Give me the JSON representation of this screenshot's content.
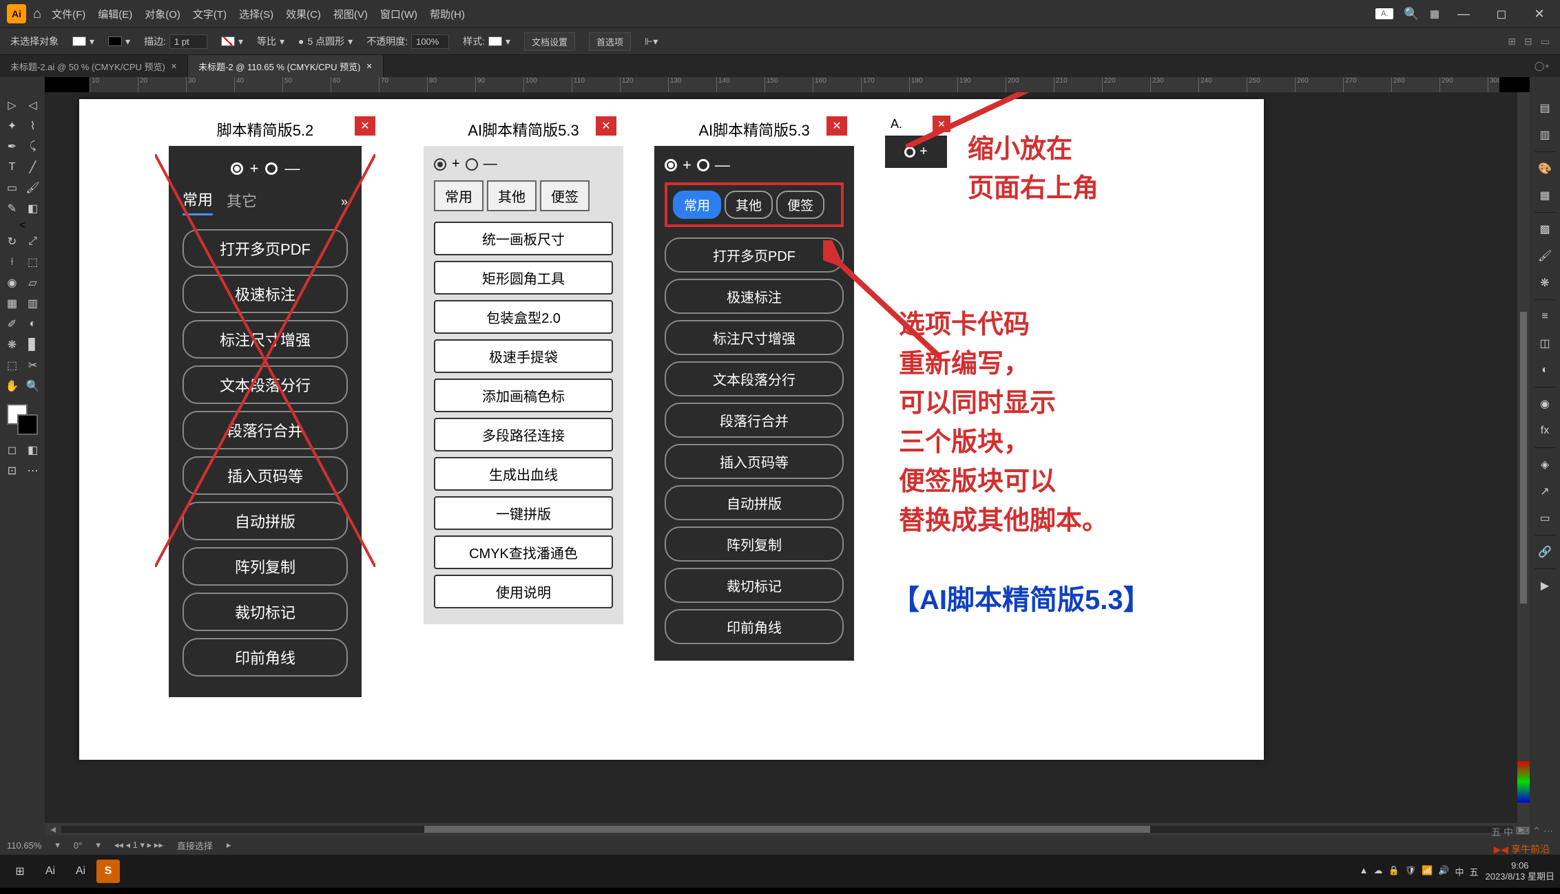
{
  "menubar": {
    "items": [
      "文件(F)",
      "编辑(E)",
      "对象(O)",
      "文字(T)",
      "选择(S)",
      "效果(C)",
      "视图(V)",
      "窗口(W)",
      "帮助(H)"
    ],
    "small_box": "A.",
    "search_icon": "search",
    "layout_icon": "layout"
  },
  "controlbar": {
    "noselect": "未选择对象",
    "stroke_label": "描边:",
    "stroke_val": "1 pt",
    "uniform": "等比",
    "pt_round": "5 点圆形",
    "opacity_label": "不透明度:",
    "opacity_val": "100%",
    "style_label": "样式:",
    "doc_setup": "文档设置",
    "prefs": "首选项"
  },
  "tabs": [
    {
      "label": "未标题-2.ai @ 50 % (CMYK/CPU 预览)",
      "active": false
    },
    {
      "label": "未标题-2 @ 110.65 % (CMYK/CPU 预览)",
      "active": true
    }
  ],
  "ruler_ticks": [
    "10",
    "20",
    "30",
    "40",
    "50",
    "60",
    "70",
    "80",
    "90",
    "100",
    "110",
    "120",
    "130",
    "140",
    "150",
    "160",
    "170",
    "180",
    "190",
    "200",
    "210",
    "220",
    "230",
    "240",
    "250",
    "260",
    "270",
    "280",
    "290",
    "300"
  ],
  "panel52": {
    "title": "脚本精简版5.2",
    "tabs": {
      "t1": "常用",
      "t2": "其它"
    },
    "buttons": [
      "打开多页PDF",
      "极速标注",
      "标注尺寸增强",
      "文本段落分行",
      "段落行合并",
      "插入页码等",
      "自动拼版",
      "阵列复制",
      "裁切标记",
      "印前角线"
    ]
  },
  "panel53a": {
    "title": "AI脚本精简版5.3",
    "tabs": {
      "t1": "常用",
      "t2": "其他",
      "t3": "便签"
    },
    "buttons": [
      "统一画板尺寸",
      "矩形圆角工具",
      "包装盒型2.0",
      "极速手提袋",
      "添加画稿色标",
      "多段路径连接",
      "生成出血线",
      "一键拼版",
      "CMYK查找潘通色",
      "使用说明"
    ]
  },
  "panel53b": {
    "title": "AI脚本精简版5.3",
    "tabs": {
      "t1": "常用",
      "t2": "其他",
      "t3": "便签"
    },
    "buttons": [
      "打开多页PDF",
      "极速标注",
      "标注尺寸增强",
      "文本段落分行",
      "段落行合并",
      "插入页码等",
      "自动拼版",
      "阵列复制",
      "裁切标记",
      "印前角线"
    ]
  },
  "panel_mini": {
    "title": "A."
  },
  "annotations": {
    "top": "缩小放在\n页面右上角",
    "mid": "选项卡代码\n重新编写，\n可以同时显示\n三个版块，\n便签版块可以\n替换成其他脚本。",
    "bottom": "【AI脚本精简版5.3】"
  },
  "status": {
    "zoom": "110.65%",
    "rot": "0°",
    "art": "1",
    "tool": "直接选择"
  },
  "taskbar": {
    "time": "9:06",
    "date": "2023/8/13 星期日"
  },
  "tray_top_icons": [
    "五",
    "中",
    "⌨",
    "⌃",
    "⋯"
  ],
  "tray_icons": [
    "▲",
    "☁",
    "🔒",
    "🛡",
    "📶",
    "🔊",
    "中",
    "五"
  ],
  "watermark": "享牛前沿"
}
